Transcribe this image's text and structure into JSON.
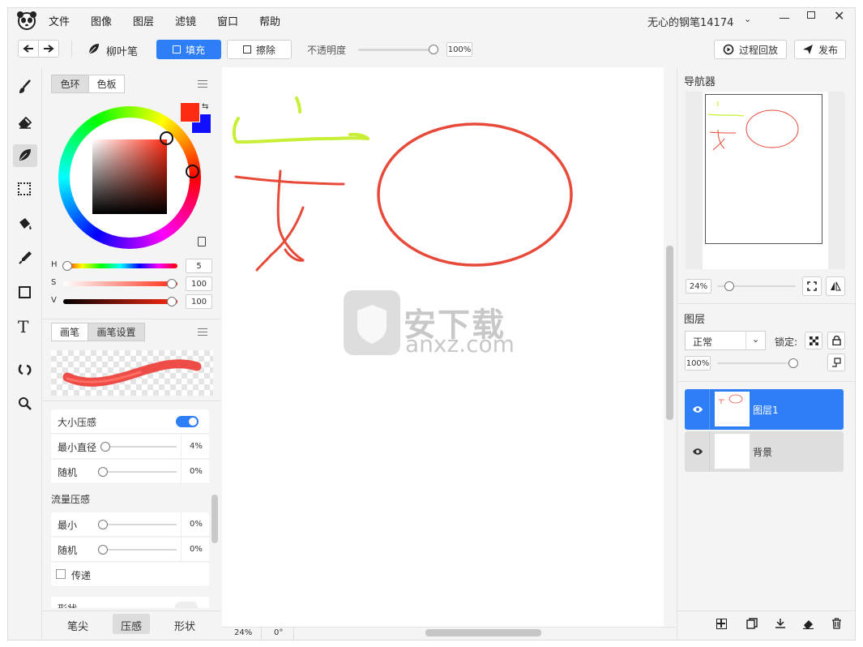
{
  "menu": [
    "文件",
    "图像",
    "图层",
    "滤镜",
    "窗口",
    "帮助"
  ],
  "title": "无心的钢笔14174",
  "toolbar": {
    "brush_name": "柳叶笔",
    "fill_label": "填充",
    "erase_label": "擦除",
    "opacity_label": "不透明度",
    "opacity_value": "100%",
    "replay_label": "过程回放",
    "publish_label": "发布"
  },
  "color_panel": {
    "tab_wheel": "色环",
    "tab_swatch": "色板",
    "primary_color": "#ff2a12",
    "secondary_color": "#1010ff",
    "h_label": "H",
    "h_value": "5",
    "s_label": "S",
    "s_value": "100",
    "v_label": "V",
    "v_value": "100"
  },
  "brush_panel": {
    "tab_brush": "画笔",
    "tab_settings": "画笔设置",
    "size_pressure_label": "大小压感",
    "min_diameter_label": "最小直径",
    "min_diameter_value": "4%",
    "random_label": "随机",
    "random_value": "0%",
    "flow_pressure_label": "流量压感",
    "flow_min_label": "最小",
    "flow_min_value": "0%",
    "flow_random_label": "随机",
    "flow_random_value": "0%",
    "transfer_label": "传递",
    "shape_label": "形状",
    "bottom_tabs": [
      "笔尖",
      "压感",
      "形状"
    ]
  },
  "status": {
    "zoom": "24%",
    "rotation": "0°"
  },
  "watermark": {
    "cn": "安下载",
    "en": "anxz.com"
  },
  "navigator": {
    "title": "导航器",
    "zoom": "24%"
  },
  "layers": {
    "title": "图层",
    "blend_mode": "正常",
    "lock_label": "锁定:",
    "opacity": "100%",
    "items": [
      {
        "name": "图层1"
      },
      {
        "name": "背景"
      }
    ]
  }
}
